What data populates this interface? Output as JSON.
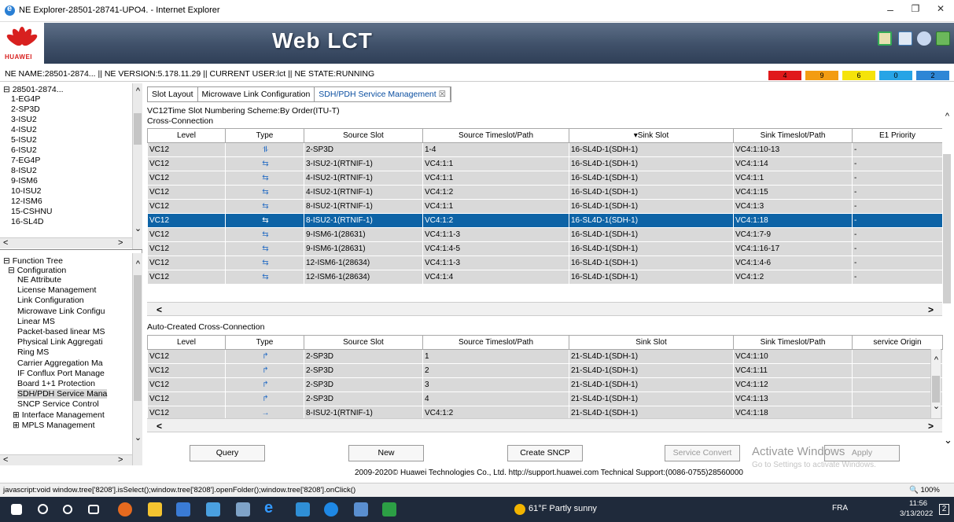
{
  "window": {
    "title": "NE Explorer-28501-28741-UPO4. - Internet Explorer",
    "min": "–",
    "max": "❐",
    "close": "✕"
  },
  "banner": {
    "logo_text": "HUAWEI",
    "app_title": "Web LCT"
  },
  "ne_bar": {
    "text": "NE NAME:28501-2874... || NE VERSION:5.178.11.29 || CURRENT USER:lct || NE STATE:RUNNING",
    "alarms": [
      {
        "count": "4",
        "color": "#e0191b"
      },
      {
        "count": "9",
        "color": "#f39c12"
      },
      {
        "count": "6",
        "color": "#f5e30a"
      },
      {
        "count": "0",
        "color": "#27a4e6"
      },
      {
        "count": "2",
        "color": "#2e86d6"
      }
    ]
  },
  "ne_tree": {
    "root": "28501-2874...",
    "items": [
      "1-EG4P",
      "2-SP3D",
      "3-ISU2",
      "4-ISU2",
      "5-ISU2",
      "6-ISU2",
      "7-EG4P",
      "8-ISU2",
      "9-ISM6",
      "10-ISU2",
      "12-ISM6",
      "15-CSHNU",
      "16-SL4D"
    ]
  },
  "function_tree": {
    "root": "Function Tree",
    "config": "Configuration",
    "items": [
      "NE Attribute",
      "License Management",
      "Link Configuration",
      "Microwave Link Configu",
      "Linear MS",
      "Packet-based linear MS",
      "Physical Link Aggregati",
      "Ring MS",
      "Carrier Aggregation Ma",
      "IF Conflux Port Manage",
      "Board 1+1 Protection",
      "SDH/PDH Service Mana",
      "SNCP Service Control",
      "Interface Management",
      "MPLS Management"
    ],
    "selected_index": 11
  },
  "tabs": [
    {
      "label": "Slot Layout"
    },
    {
      "label": "Microwave Link Configuration"
    },
    {
      "label": "SDH/PDH Service Management"
    }
  ],
  "tab_close": "☒",
  "scheme": "VC12Time Slot Numbering Scheme:By Order(ITU-T)",
  "cross_connection": {
    "title": "Cross-Connection",
    "headers": [
      "Level",
      "Type",
      "Source Slot",
      "Source Timeslot/Path",
      "▾Sink Slot",
      "Sink Timeslot/Path",
      "E1 Priority"
    ],
    "rows": [
      [
        "VC12",
        "⥮",
        "2-SP3D",
        "1-4",
        "16-SL4D-1(SDH-1)",
        "VC4:1:10-13",
        "-"
      ],
      [
        "VC12",
        "⇆",
        "3-ISU2-1(RTNIF-1)",
        "VC4:1:1",
        "16-SL4D-1(SDH-1)",
        "VC4:1:14",
        "-"
      ],
      [
        "VC12",
        "⇆",
        "4-ISU2-1(RTNIF-1)",
        "VC4:1:1",
        "16-SL4D-1(SDH-1)",
        "VC4:1:1",
        "-"
      ],
      [
        "VC12",
        "⇆",
        "4-ISU2-1(RTNIF-1)",
        "VC4:1:2",
        "16-SL4D-1(SDH-1)",
        "VC4:1:15",
        "-"
      ],
      [
        "VC12",
        "⇆",
        "8-ISU2-1(RTNIF-1)",
        "VC4:1:1",
        "16-SL4D-1(SDH-1)",
        "VC4:1:3",
        "-"
      ],
      [
        "VC12",
        "⇆",
        "8-ISU2-1(RTNIF-1)",
        "VC4:1:2",
        "16-SL4D-1(SDH-1)",
        "VC4:1:18",
        "-"
      ],
      [
        "VC12",
        "⇆",
        "9-ISM6-1(28631)",
        "VC4:1:1-3",
        "16-SL4D-1(SDH-1)",
        "VC4:1:7-9",
        "-"
      ],
      [
        "VC12",
        "⇆",
        "9-ISM6-1(28631)",
        "VC4:1:4-5",
        "16-SL4D-1(SDH-1)",
        "VC4:1:16-17",
        "-"
      ],
      [
        "VC12",
        "⇆",
        "12-ISM6-1(28634)",
        "VC4:1:1-3",
        "16-SL4D-1(SDH-1)",
        "VC4:1:4-6",
        "-"
      ],
      [
        "VC12",
        "⇆",
        "12-ISM6-1(28634)",
        "VC4:1:4",
        "16-SL4D-1(SDH-1)",
        "VC4:1:2",
        "-"
      ]
    ],
    "selected_row": 5
  },
  "auto_cross_connection": {
    "title": "Auto-Created Cross-Connection",
    "headers": [
      "Level",
      "Type",
      "Source Slot",
      "Source Timeslot/Path",
      "Sink Slot",
      "Sink Timeslot/Path",
      "service Origin"
    ],
    "rows": [
      [
        "VC12",
        "↱",
        "2-SP3D",
        "1",
        "21-SL4D-1(SDH-1)",
        "VC4:1:10",
        ""
      ],
      [
        "VC12",
        "↱",
        "2-SP3D",
        "2",
        "21-SL4D-1(SDH-1)",
        "VC4:1:11",
        ""
      ],
      [
        "VC12",
        "↱",
        "2-SP3D",
        "3",
        "21-SL4D-1(SDH-1)",
        "VC4:1:12",
        ""
      ],
      [
        "VC12",
        "↱",
        "2-SP3D",
        "4",
        "21-SL4D-1(SDH-1)",
        "VC4:1:13",
        ""
      ],
      [
        "VC12",
        "→",
        "8-ISU2-1(RTNIF-1)",
        "VC4:1:2",
        "21-SL4D-1(SDH-1)",
        "VC4:1:18",
        ""
      ]
    ]
  },
  "buttons": {
    "query": "Query",
    "new": "New",
    "create_sncp": "Create SNCP",
    "service_convert": "Service Convert",
    "apply": "Apply"
  },
  "watermark": {
    "line1": "Activate Windows",
    "line2": "Go to Settings to activate Windows."
  },
  "footer": "2009-2020© Huawei Technologies Co., Ltd. http://support.huawei.com Technical Support:(0086-0755)28560000",
  "status": {
    "url": "javascript:void window.tree['8208'].isSelect();window.tree['8208'].openFolder();window.tree['8208'].onClick()",
    "zoom": "🔍 100%"
  },
  "taskbar": {
    "weather": "61°F  Partly sunny",
    "lang": "FRA",
    "time": "11:56",
    "date": "3/13/2022",
    "notif_count": "2"
  },
  "scroll_glyphs": {
    "up": "^",
    "down": "⌄",
    "left": "<",
    "right": ">"
  }
}
